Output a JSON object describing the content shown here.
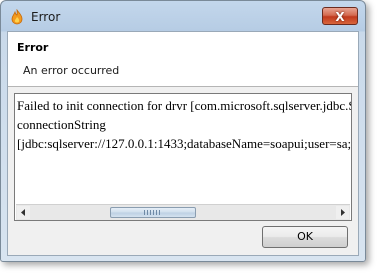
{
  "window": {
    "title": "Error",
    "close_label": "X"
  },
  "header": {
    "title": "Error",
    "message": "An error occurred"
  },
  "details": {
    "text": "Failed to init connection for drvr [com.microsoft.sqlserver.jdbc.SQLServerDriver]\nconnectionString\n[jdbc:sqlserver://127.0.0.1:1433;databaseName=soapui;user=sa;password=sa]"
  },
  "buttons": {
    "ok_label": "OK"
  },
  "colors": {
    "title_bar": "#b6cce4",
    "close_button": "#c1391c",
    "header_bg": "#ffffff",
    "dialog_bg": "#f0f0f0"
  },
  "icons": {
    "app": "soapui-logo-icon",
    "close": "close-icon",
    "scroll_left": "arrow-left-icon",
    "scroll_right": "arrow-right-icon"
  }
}
